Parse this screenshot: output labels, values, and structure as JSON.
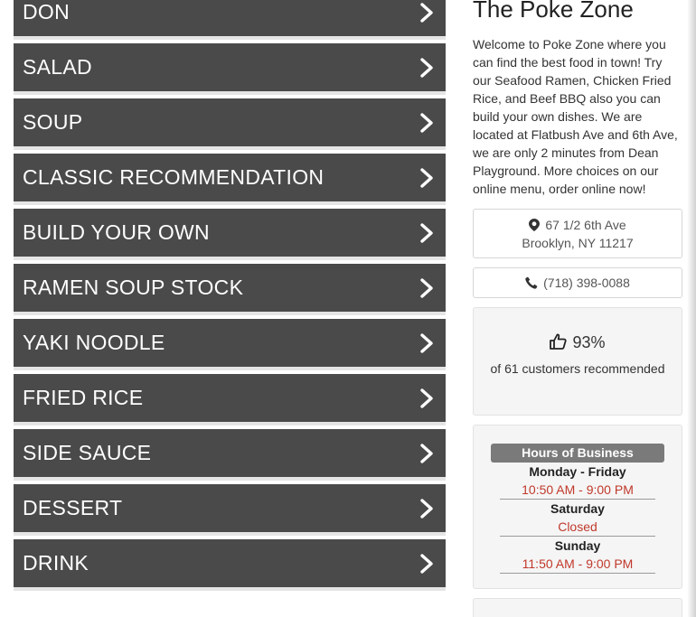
{
  "menu": {
    "categories": [
      {
        "label": "DON"
      },
      {
        "label": "SALAD"
      },
      {
        "label": "SOUP"
      },
      {
        "label": "CLASSIC RECOMMENDATION"
      },
      {
        "label": "BUILD YOUR OWN"
      },
      {
        "label": "RAMEN SOUP STOCK"
      },
      {
        "label": "YAKI NOODLE"
      },
      {
        "label": "FRIED RICE"
      },
      {
        "label": "SIDE SAUCE"
      },
      {
        "label": "DESSERT"
      },
      {
        "label": "DRINK"
      }
    ]
  },
  "store": {
    "title": "The Poke Zone",
    "description": "Welcome to Poke Zone where you can find the best food in town! Try our Seafood Ramen, Chicken Fried Rice, and Beef BBQ also you can build your own dishes. We are located at Flatbush Ave and 6th Ave, we are only 2 minutes from Dean Playground. More choices on our online menu, order online now!",
    "address_line1": "67 1/2 6th Ave",
    "address_line2": "Brooklyn, NY 11217",
    "phone": "(718) 398-0088",
    "address_icon": "map-marker-icon",
    "phone_icon": "phone-icon"
  },
  "recommendation": {
    "percent": "93%",
    "text": "of 61 customers recommended",
    "icon": "thumbs-up-icon"
  },
  "hours": {
    "heading": "Hours of Business",
    "rows": [
      {
        "day": "Monday - Friday",
        "time": "10:50 AM - 9:00 PM"
      },
      {
        "day": "Saturday",
        "time": "Closed"
      },
      {
        "day": "Sunday",
        "time": "11:50 AM - 9:00 PM"
      }
    ]
  },
  "colors": {
    "category_bg": "#4a4a4a",
    "hours_time": "#c0392b"
  }
}
